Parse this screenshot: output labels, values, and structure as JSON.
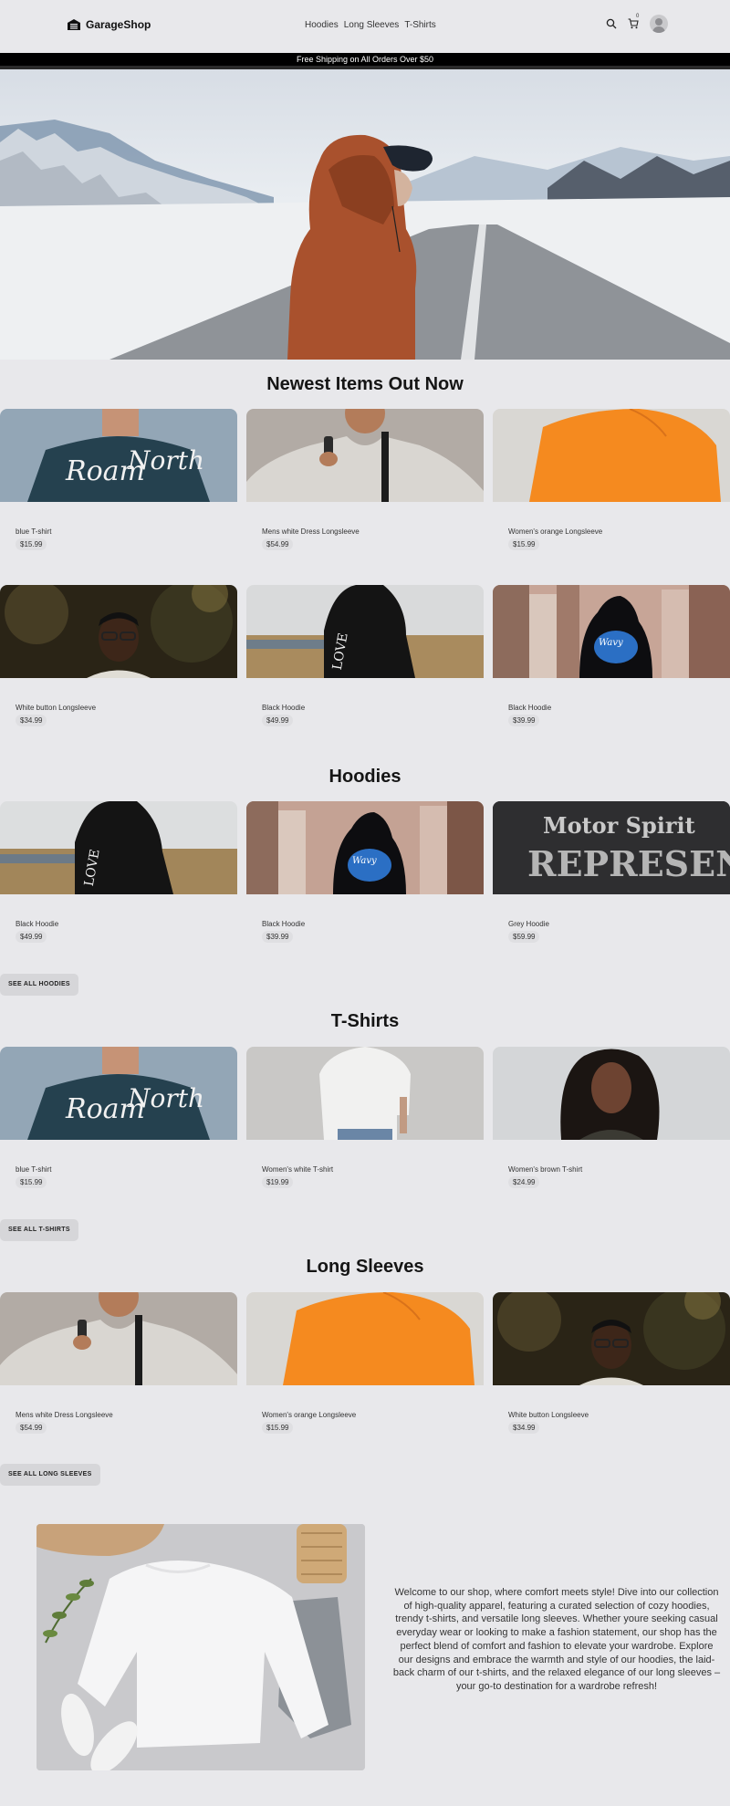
{
  "header": {
    "logo": "GarageShop",
    "nav": [
      "Hoodies",
      "Long Sleeves",
      "T-Shirts"
    ],
    "cart_count": "0"
  },
  "announcement": "Free Shipping on All Orders Over $50",
  "sections": {
    "newest": {
      "title": "Newest Items Out Now",
      "items": [
        {
          "name": "blue T-shirt",
          "price": "$15.99"
        },
        {
          "name": "Mens white Dress Longsleeve",
          "price": "$54.99"
        },
        {
          "name": "Women's orange Longsleeve",
          "price": "$15.99"
        },
        {
          "name": "White button Longsleeve",
          "price": "$34.99"
        },
        {
          "name": "Black Hoodie",
          "price": "$49.99"
        },
        {
          "name": "Black Hoodie",
          "price": "$39.99"
        }
      ]
    },
    "hoodies": {
      "title": "Hoodies",
      "items": [
        {
          "name": "Black Hoodie",
          "price": "$49.99"
        },
        {
          "name": "Black Hoodie",
          "price": "$39.99"
        },
        {
          "name": "Grey Hoodie",
          "price": "$59.99"
        }
      ],
      "see_all": "SEE ALL HOODIES"
    },
    "tshirts": {
      "title": "T-Shirts",
      "items": [
        {
          "name": "blue T-shirt",
          "price": "$15.99"
        },
        {
          "name": "Women's white T-shirt",
          "price": "$19.99"
        },
        {
          "name": "Women's brown T-shirt",
          "price": "$24.99"
        }
      ],
      "see_all": "SEE ALL T-SHIRTS"
    },
    "longsleeves": {
      "title": "Long Sleeves",
      "items": [
        {
          "name": "Mens white Dress Longsleeve",
          "price": "$54.99"
        },
        {
          "name": "Women's orange Longsleeve",
          "price": "$15.99"
        },
        {
          "name": "White button Longsleeve",
          "price": "$34.99"
        }
      ],
      "see_all": "SEE ALL LONG SLEEVES"
    }
  },
  "welcome_text": "Welcome to our shop, where comfort meets style! Dive into our collection of high-quality apparel, featuring a curated selection of cozy hoodies, trendy t-shirts, and versatile long sleeves. Whether youre seeking casual everyday wear or looking to make a fashion statement, our shop has the perfect blend of comfort and fashion to elevate your wardrobe. Explore our designs and embrace the warmth and style of our hoodies, the laid-back charm of our t-shirts, and the relaxed elegance of our long sleeves – your go-to destination for a wardrobe refresh!",
  "colors": {
    "background": "#e8e8eb",
    "announcement_bar": "#000000",
    "price_pill": "#dfdfe2",
    "button": "#d6d6d9"
  },
  "icons": [
    "garage-logo-icon",
    "search-icon",
    "cart-icon",
    "user-avatar-icon"
  ]
}
